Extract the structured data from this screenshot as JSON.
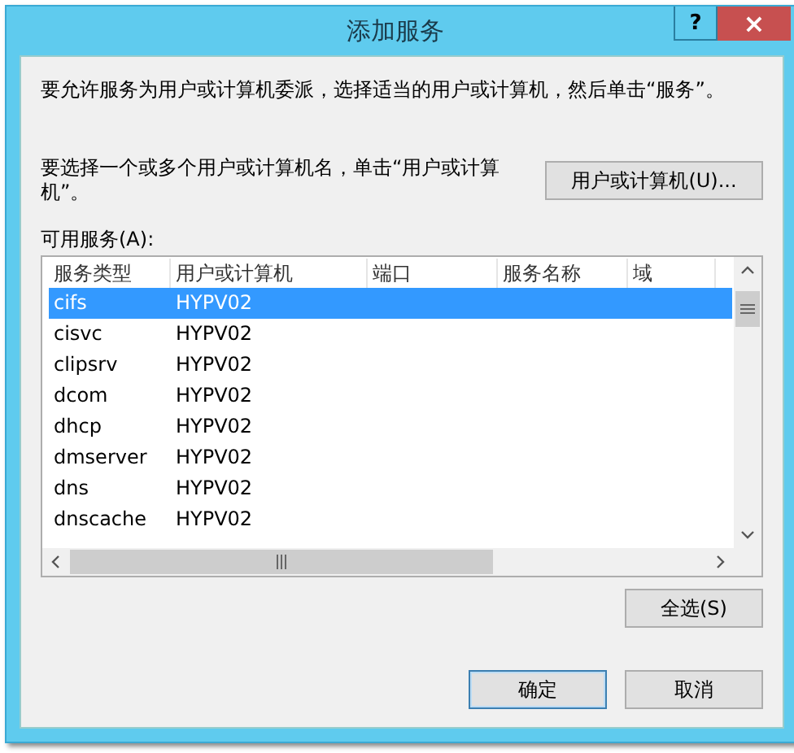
{
  "window": {
    "title": "添加服务",
    "help_button": "?",
    "close_button": "×"
  },
  "description": "要允许服务为用户或计算机委派，选择适当的用户或计算机，然后单击“服务”。",
  "select_hint": "要选择一个或多个用户或计算机名，单击“用户或计算机”。",
  "select_button": "用户或计算机(U)...",
  "list_label": "可用服务(A):",
  "table": {
    "columns": [
      "服务类型",
      "用户或计算机",
      "端口",
      "服务名称",
      "域"
    ],
    "rows": [
      {
        "cells": [
          "cifs",
          "HYPV02"
        ],
        "selected": true
      },
      {
        "cells": [
          "cisvc",
          "HYPV02"
        ],
        "selected": false
      },
      {
        "cells": [
          "clipsrv",
          "HYPV02"
        ],
        "selected": false
      },
      {
        "cells": [
          "dcom",
          "HYPV02"
        ],
        "selected": false
      },
      {
        "cells": [
          "dhcp",
          "HYPV02"
        ],
        "selected": false
      },
      {
        "cells": [
          "dmserver",
          "HYPV02"
        ],
        "selected": false
      },
      {
        "cells": [
          "dns",
          "HYPV02"
        ],
        "selected": false
      },
      {
        "cells": [
          "dnscache",
          "HYPV02"
        ],
        "selected": false
      }
    ]
  },
  "select_all_button": "全选(S)",
  "buttons": [
    {
      "label": "确定",
      "kind": "default"
    },
    {
      "label": "取消",
      "kind": "normal"
    }
  ]
}
